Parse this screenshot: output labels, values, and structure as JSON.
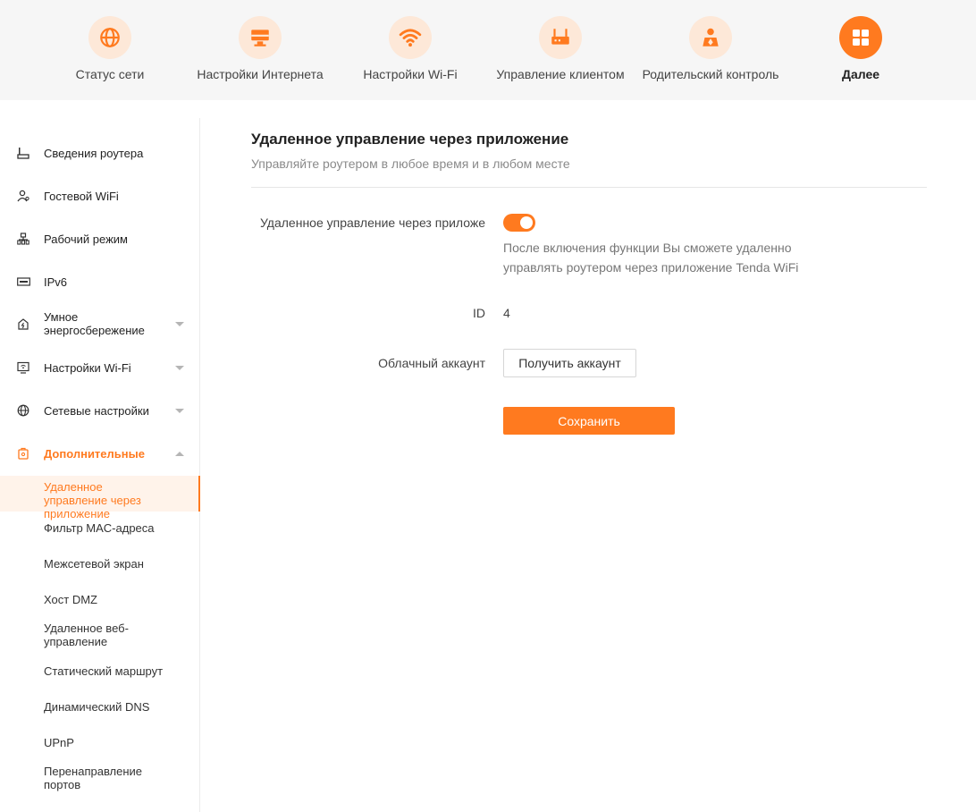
{
  "topnav": {
    "items": [
      {
        "label": "Статус сети",
        "icon": "globe-icon"
      },
      {
        "label": "Настройки Интернета",
        "icon": "monitor-icon"
      },
      {
        "label": "Настройки Wi-Fi",
        "icon": "wifi-icon"
      },
      {
        "label": "Управление клиентом",
        "icon": "router-icon"
      },
      {
        "label": "Родительский контроль",
        "icon": "parental-icon"
      },
      {
        "label": "Далее",
        "icon": "grid-icon",
        "active": true
      }
    ]
  },
  "sidebar": {
    "items": [
      {
        "label": "Сведения роутера",
        "icon": "router-info-icon"
      },
      {
        "label": "Гостевой WiFi",
        "icon": "guest-icon"
      },
      {
        "label": "Рабочий режим",
        "icon": "mode-icon"
      },
      {
        "label": "IPv6",
        "icon": "ipv6-icon"
      },
      {
        "label": "Умное энергосбережение",
        "icon": "energy-icon"
      },
      {
        "label": "Настройки Wi-Fi",
        "icon": "wifi-settings-icon"
      },
      {
        "label": "Сетевые настройки",
        "icon": "network-icon"
      },
      {
        "label": "Дополнительные",
        "icon": "advanced-icon"
      }
    ],
    "subitems": [
      {
        "label": "Удаленное управление через приложение"
      },
      {
        "label": "Фильтр MAC-адреса"
      },
      {
        "label": "Межсетевой экран"
      },
      {
        "label": "Хост DMZ"
      },
      {
        "label": "Удаленное веб-управление"
      },
      {
        "label": "Статический маршрут"
      },
      {
        "label": "Динамический DNS"
      },
      {
        "label": "UPnP"
      },
      {
        "label": "Перенаправление портов"
      }
    ]
  },
  "main": {
    "title": "Удаленное управление через приложение",
    "subtitle": "Управляйте роутером в любое время и в любом месте",
    "toggle_label": "Удаленное управление через приложение",
    "toggle_on": true,
    "hint": "После включения функции Вы сможете удаленно управлять роутером через приложение Tenda WiFi",
    "id_label": "ID",
    "id_value": "4",
    "cloud_label": "Облачный аккаунт",
    "get_account_button": "Получить аккаунт",
    "save_button": "Сохранить"
  },
  "colors": {
    "accent": "#ff7a1f",
    "accent_light": "#fde8d8"
  }
}
